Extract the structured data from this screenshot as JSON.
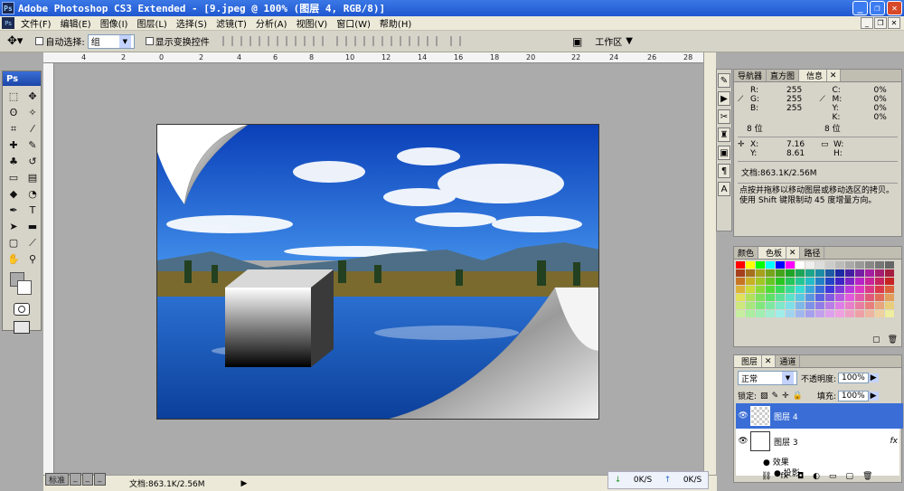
{
  "window": {
    "app_icon": "Ps",
    "title": "Adobe Photoshop CS3 Extended - [9.jpeg @ 100% (图层 4, RGB/8)]",
    "min": "_",
    "max": "❐",
    "close": "✕"
  },
  "menu": {
    "items": [
      "文件(F)",
      "编辑(E)",
      "图像(I)",
      "图层(L)",
      "选择(S)",
      "滤镜(T)",
      "分析(A)",
      "视图(V)",
      "窗口(W)",
      "帮助(H)"
    ],
    "mdi_min": "_",
    "mdi_max": "❐",
    "mdi_close": "✕"
  },
  "options": {
    "auto_select_label": "自动选择:",
    "auto_select_value": "组",
    "show_transform_label": "显示变换控件",
    "workspace_label": "工作区"
  },
  "toolbox": {
    "logo": "Ps",
    "tools": [
      "marquee-icon",
      "move-icon",
      "lasso-icon",
      "magic-wand-icon",
      "crop-icon",
      "slice-icon",
      "healing-brush-icon",
      "brush-icon",
      "clone-stamp-icon",
      "history-brush-icon",
      "eraser-icon",
      "gradient-icon",
      "blur-icon",
      "dodge-icon",
      "pen-icon",
      "type-icon",
      "path-select-icon",
      "shape-icon",
      "notes-icon",
      "eyedropper-icon",
      "hand-icon",
      "zoom-icon"
    ],
    "fg_color": "#aaaaaa",
    "bg_color": "#ffffff"
  },
  "ruler": {
    "top_ticks": [
      "4",
      "2",
      "0",
      "2",
      "4",
      "6",
      "8",
      "10",
      "12",
      "14",
      "16",
      "18",
      "20",
      "22",
      "24",
      "26",
      "28"
    ]
  },
  "status": {
    "doc_info": "文档:863.1K/2.56M",
    "mode": "标准",
    "upload": "0K/S",
    "download": "0K/S"
  },
  "navigator_panel": {
    "tabs": [
      "导航器",
      "直方图",
      "信息"
    ],
    "active_tab": "信息",
    "rgb": {
      "R": "255",
      "G": "255",
      "B": "255"
    },
    "cmyk": {
      "C": "0%",
      "M": "0%",
      "Y": "0%",
      "K": "0%"
    },
    "bits1": "8 位",
    "bits2": "8 位",
    "x": "7.16",
    "y": "8.61",
    "w": "",
    "h": "",
    "doc": "文档:863.1K/2.56M",
    "hint": "点按并拖移以移动图层或移动选区的拷贝。使用 Shift 键限制动 45 度增量方向。"
  },
  "swatches_panel": {
    "tabs": [
      "颜色",
      "色板",
      "路径"
    ],
    "active_tab": "色板"
  },
  "layers_panel": {
    "tabs": [
      "图层",
      "通道"
    ],
    "active_tab": "图层",
    "blend_mode": "正常",
    "opacity_label": "不透明度:",
    "opacity": "100%",
    "lock_label": "锁定:",
    "fill_label": "填充:",
    "fill": "100%",
    "layers": [
      {
        "name": "图层 4",
        "selected": true
      },
      {
        "name": "图层 3",
        "selected": false
      }
    ],
    "effects_label": "效果",
    "effect_item": "投影"
  },
  "colors": {
    "titlebar": "#2a63d9",
    "selected_layer": "#3a6ed6"
  }
}
